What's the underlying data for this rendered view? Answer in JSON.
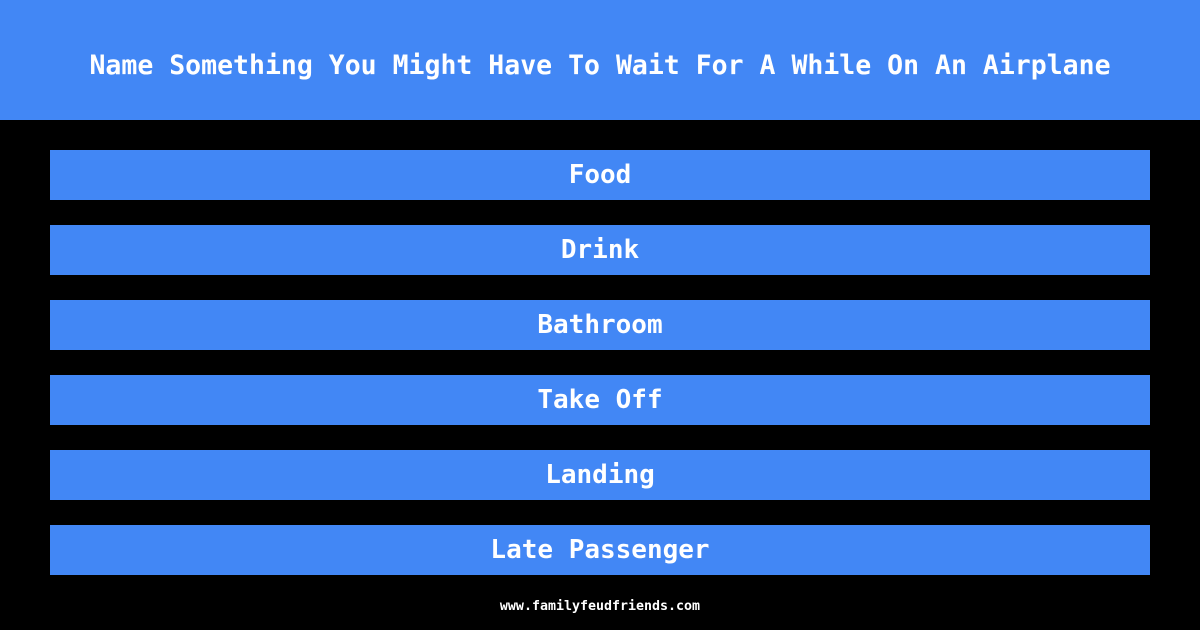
{
  "header": {
    "question": "Name Something You Might Have To Wait For A While On An Airplane"
  },
  "answers": [
    {
      "label": "Food"
    },
    {
      "label": "Drink"
    },
    {
      "label": "Bathroom"
    },
    {
      "label": "Take Off"
    },
    {
      "label": "Landing"
    },
    {
      "label": "Late Passenger"
    }
  ],
  "footer": {
    "site": "www.familyfeudfriends.com"
  },
  "colors": {
    "accent": "#4287f5",
    "background": "#000000",
    "text": "#ffffff"
  }
}
